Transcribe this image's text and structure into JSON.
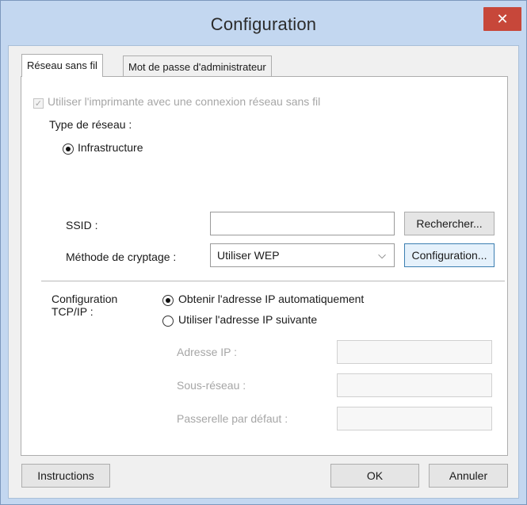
{
  "window": {
    "title": "Configuration",
    "close_glyph": "✕"
  },
  "tabs": [
    {
      "label": "Réseau sans fil",
      "active": true
    },
    {
      "label": "Mot de passe d'administrateur",
      "active": false
    }
  ],
  "wireless": {
    "use_wireless_label": "Utiliser l'imprimante avec une connexion réseau sans fil",
    "use_wireless_checked": true,
    "network_type_label": "Type de réseau :",
    "infrastructure_label": "Infrastructure",
    "ssid_label": "SSID :",
    "ssid_value": "",
    "search_button": "Rechercher...",
    "encryption_label": "Méthode de cryptage :",
    "encryption_value": "Utiliser WEP",
    "encryption_config_button": "Configuration..."
  },
  "tcpip": {
    "label_line1": "Configuration",
    "label_line2": "TCP/IP :",
    "auto_ip_label": "Obtenir l'adresse IP automatiquement",
    "manual_ip_label": "Utiliser l'adresse IP suivante",
    "ip_address_label": "Adresse IP :",
    "ip_address_value": "",
    "subnet_label": "Sous-réseau :",
    "subnet_value": "",
    "gateway_label": "Passerelle par défaut :",
    "gateway_value": ""
  },
  "footer": {
    "instructions_button": "Instructions",
    "ok_button": "OK",
    "cancel_button": "Annuler"
  },
  "colors": {
    "close_button": "#c7473a",
    "frame": "#c3d7f0",
    "focus_border": "#3c7fb1"
  },
  "icons": {
    "close": "close-icon",
    "dropdown": "chevron-down-icon",
    "checkbox": "checkmark-icon"
  }
}
